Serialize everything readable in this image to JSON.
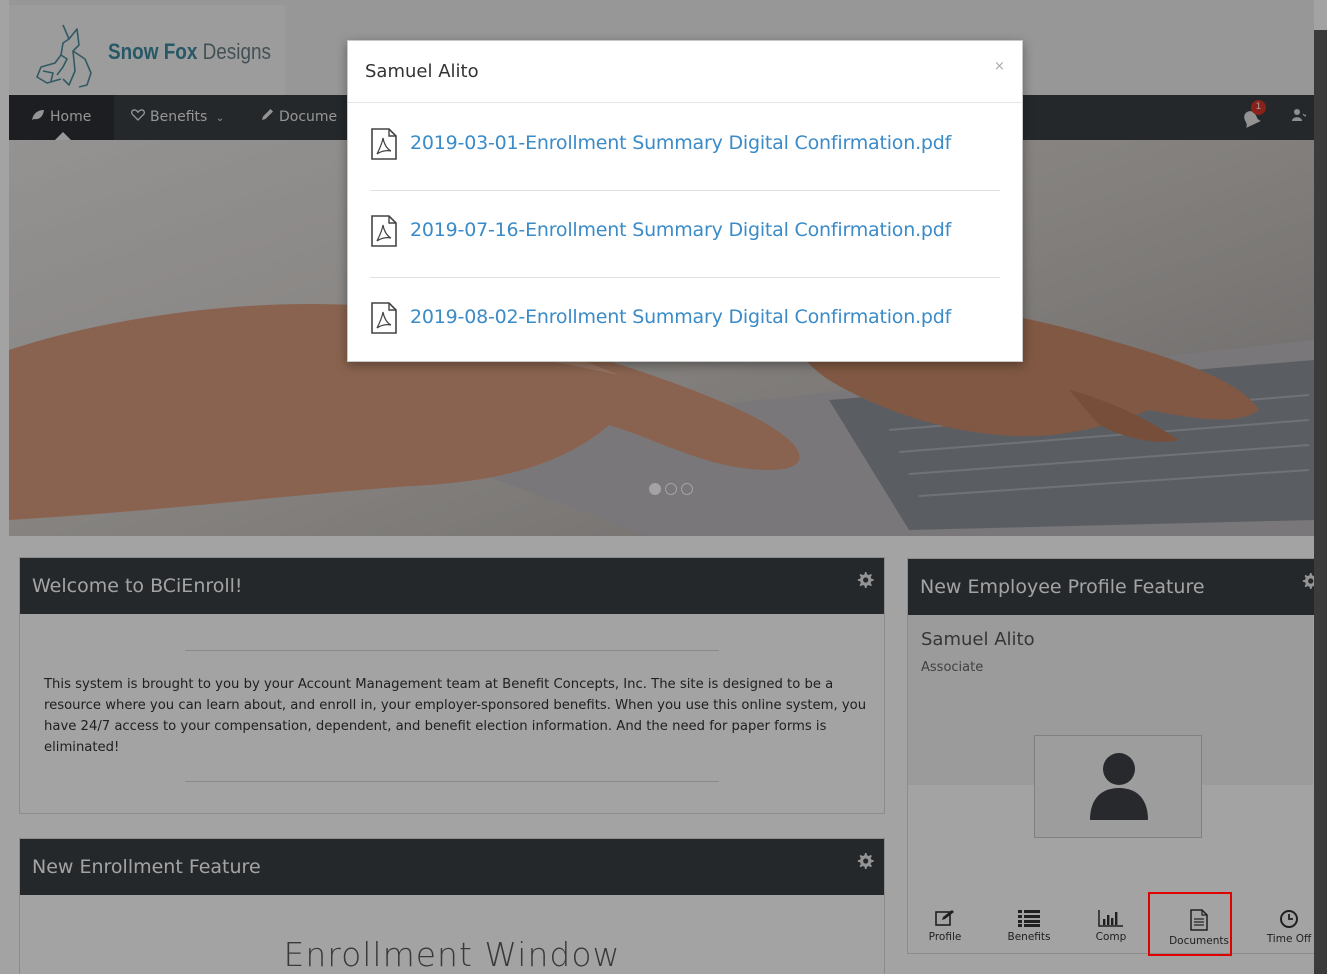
{
  "brand": {
    "logo_bold": "Snow Fox",
    "logo_rest": " Designs"
  },
  "nav": {
    "items": [
      {
        "label": "Home",
        "icon": "leaf-icon"
      },
      {
        "label": "Benefits",
        "icon": "heart-icon"
      },
      {
        "label": "Docume",
        "icon": "pencil-icon"
      }
    ],
    "notification_count": "1"
  },
  "hero": {
    "slides": 3,
    "active_slide": 1
  },
  "welcome": {
    "title": "Welcome to BCiEnroll!",
    "body": "This system is brought to you by your Account Management team at Benefit Concepts, Inc.  The site is designed to be a resource where you can learn about, and enroll in, your employer-sponsored benefits.  When you use this online system, you have 24/7 access to your compensation, dependent, and benefit election information.  And the need for paper forms is eliminated!"
  },
  "enrollment": {
    "title": "New Enrollment Feature",
    "heading": "Enrollment Window"
  },
  "profile_panel": {
    "title": "New Employee Profile Feature",
    "name": "Samuel Alito",
    "role": "Associate",
    "tabs": [
      "Profile",
      "Benefits",
      "Comp",
      "Documents",
      "Time Off"
    ],
    "highlighted_tab": "Documents"
  },
  "modal": {
    "title": "Samuel Alito",
    "close": "×",
    "documents": [
      "2019-03-01-Enrollment Summary Digital Confirmation.pdf",
      "2019-07-16-Enrollment Summary Digital Confirmation.pdf",
      "2019-08-02-Enrollment Summary Digital Confirmation.pdf"
    ]
  },
  "colors": {
    "nav_bg": "#3b3f44",
    "link": "#3a8bc7",
    "brand": "#3d8aa0",
    "badge": "#d9342b",
    "highlight": "#e00000"
  }
}
